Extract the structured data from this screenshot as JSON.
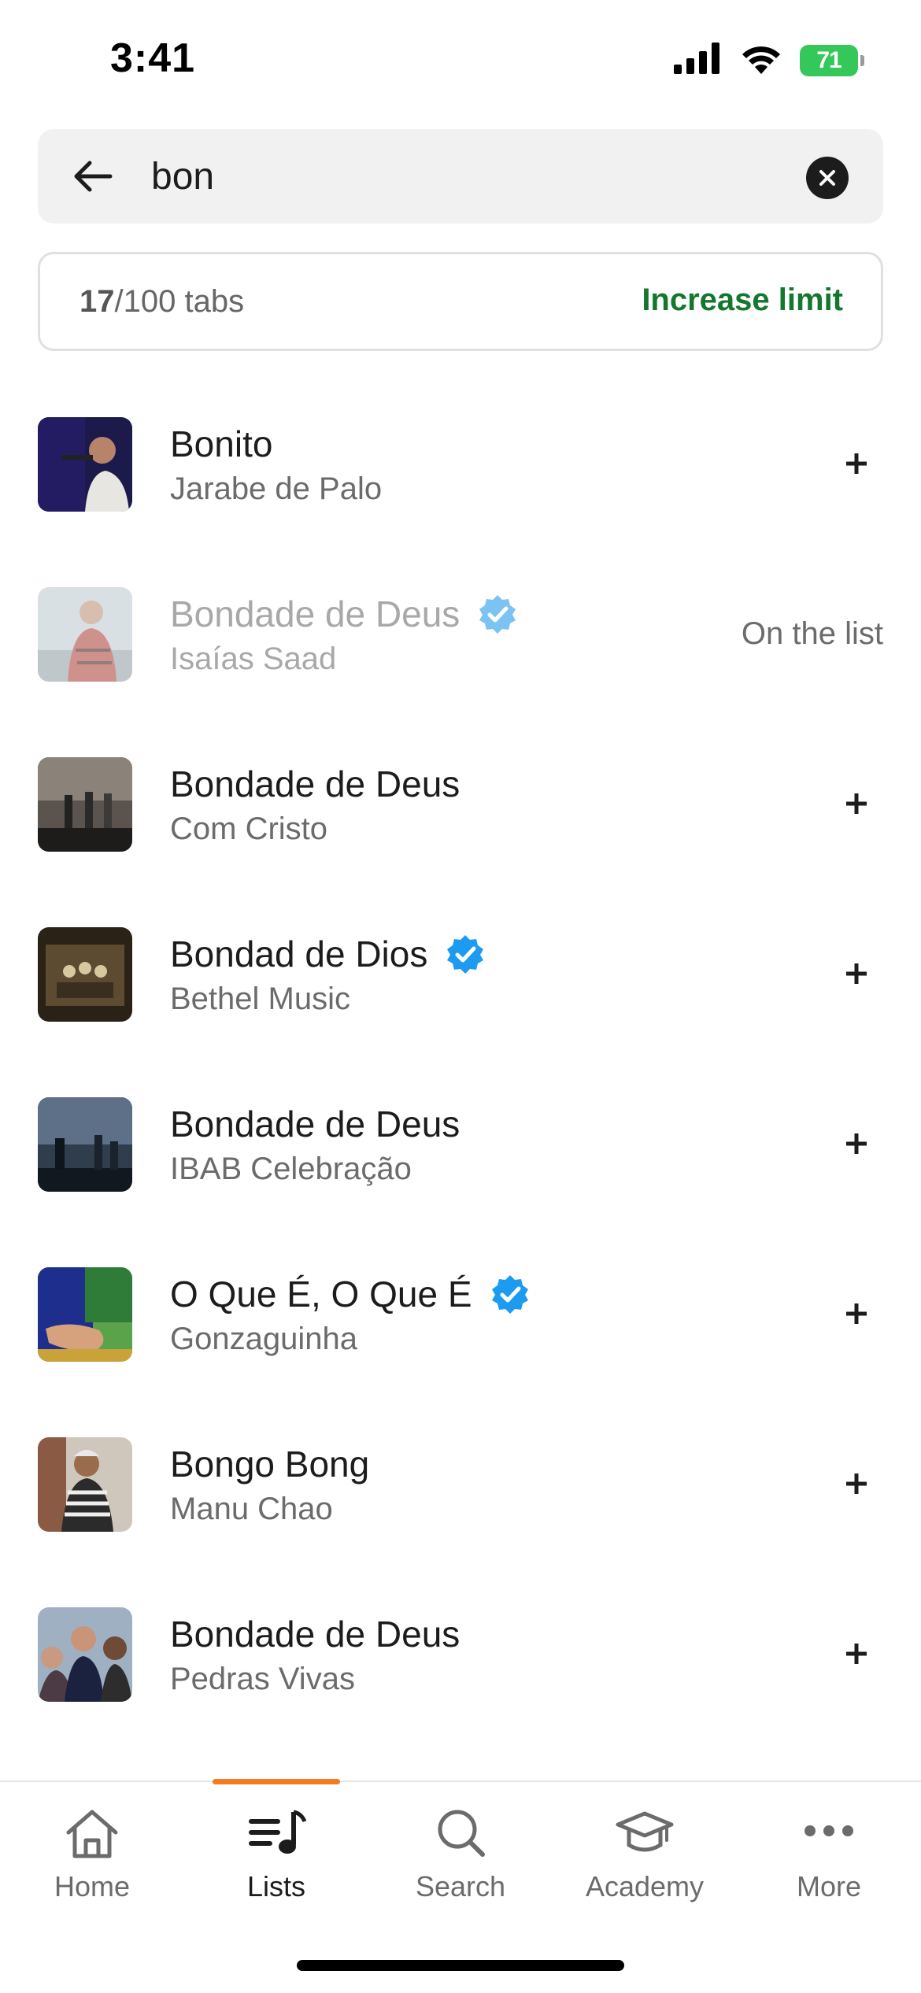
{
  "status_bar": {
    "time": "3:41",
    "battery": "71"
  },
  "search": {
    "value": "bon"
  },
  "limit": {
    "count": "17",
    "suffix": "/100 tabs",
    "action": "Increase limit"
  },
  "results": [
    {
      "title": "Bonito",
      "artist": "Jarabe de Palo",
      "verified": false,
      "status": "add"
    },
    {
      "title": "Bondade de Deus",
      "artist": "Isaías Saad",
      "verified": true,
      "status": "on_list",
      "status_label": "On the list"
    },
    {
      "title": "Bondade de Deus",
      "artist": "Com Cristo",
      "verified": false,
      "status": "add"
    },
    {
      "title": "Bondad de Dios",
      "artist": "Bethel Music",
      "verified": true,
      "status": "add"
    },
    {
      "title": "Bondade de Deus",
      "artist": "IBAB Celebração",
      "verified": false,
      "status": "add"
    },
    {
      "title": "O Que É, O Que É",
      "artist": "Gonzaguinha",
      "verified": true,
      "status": "add"
    },
    {
      "title": "Bongo Bong",
      "artist": "Manu Chao",
      "verified": false,
      "status": "add"
    },
    {
      "title": "Bondade de Deus",
      "artist": "Pedras Vivas",
      "verified": false,
      "status": "add"
    }
  ],
  "tabs": [
    {
      "label": "Home",
      "icon": "home-icon"
    },
    {
      "label": "Lists",
      "icon": "lists-icon",
      "active": true
    },
    {
      "label": "Search",
      "icon": "search-icon"
    },
    {
      "label": "Academy",
      "icon": "academy-icon"
    },
    {
      "label": "More",
      "icon": "more-icon"
    }
  ],
  "colors": {
    "accent": "#14772e",
    "tab_indicator": "#f47a1f",
    "verified": "#1d9bf0",
    "battery": "#34c759"
  }
}
